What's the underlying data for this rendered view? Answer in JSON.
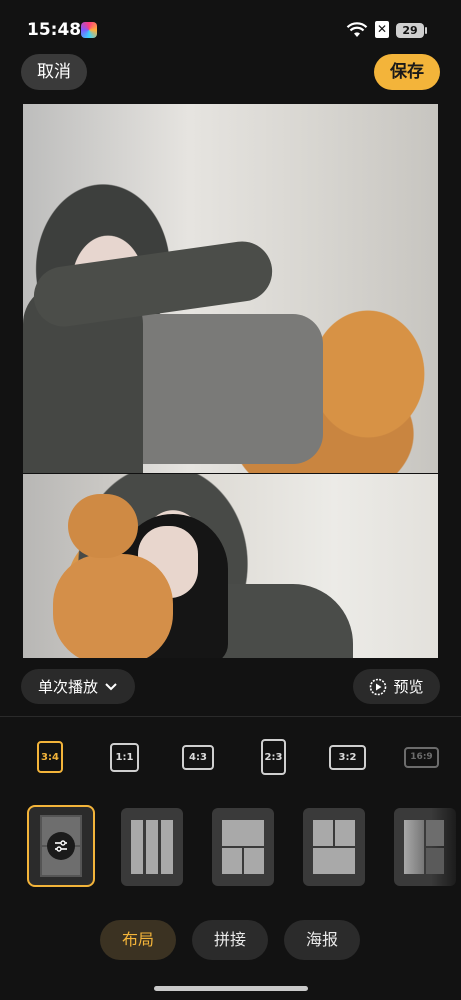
{
  "status": {
    "time": "15:48",
    "battery": "29"
  },
  "header": {
    "cancel": "取消",
    "save": "保存"
  },
  "controls": {
    "play_mode": "单次播放",
    "preview": "预览"
  },
  "ratios": [
    {
      "label": "3:4",
      "state": "active"
    },
    {
      "label": "1:1",
      "state": "normal"
    },
    {
      "label": "4:3",
      "state": "normal"
    },
    {
      "label": "2:3",
      "state": "normal"
    },
    {
      "label": "3:2",
      "state": "normal"
    },
    {
      "label": "16:9",
      "state": "faded"
    }
  ],
  "tabs": [
    {
      "label": "布局",
      "active": true
    },
    {
      "label": "拼接",
      "active": false
    },
    {
      "label": "海报",
      "active": false
    }
  ],
  "colors": {
    "accent": "#f3b43a",
    "background": "#121212",
    "chip": "#2a2a2a"
  },
  "icons": [
    "wifi-icon",
    "sim-icon",
    "battery-icon",
    "chevron-down-icon",
    "play-circle-icon",
    "sliders-icon"
  ]
}
